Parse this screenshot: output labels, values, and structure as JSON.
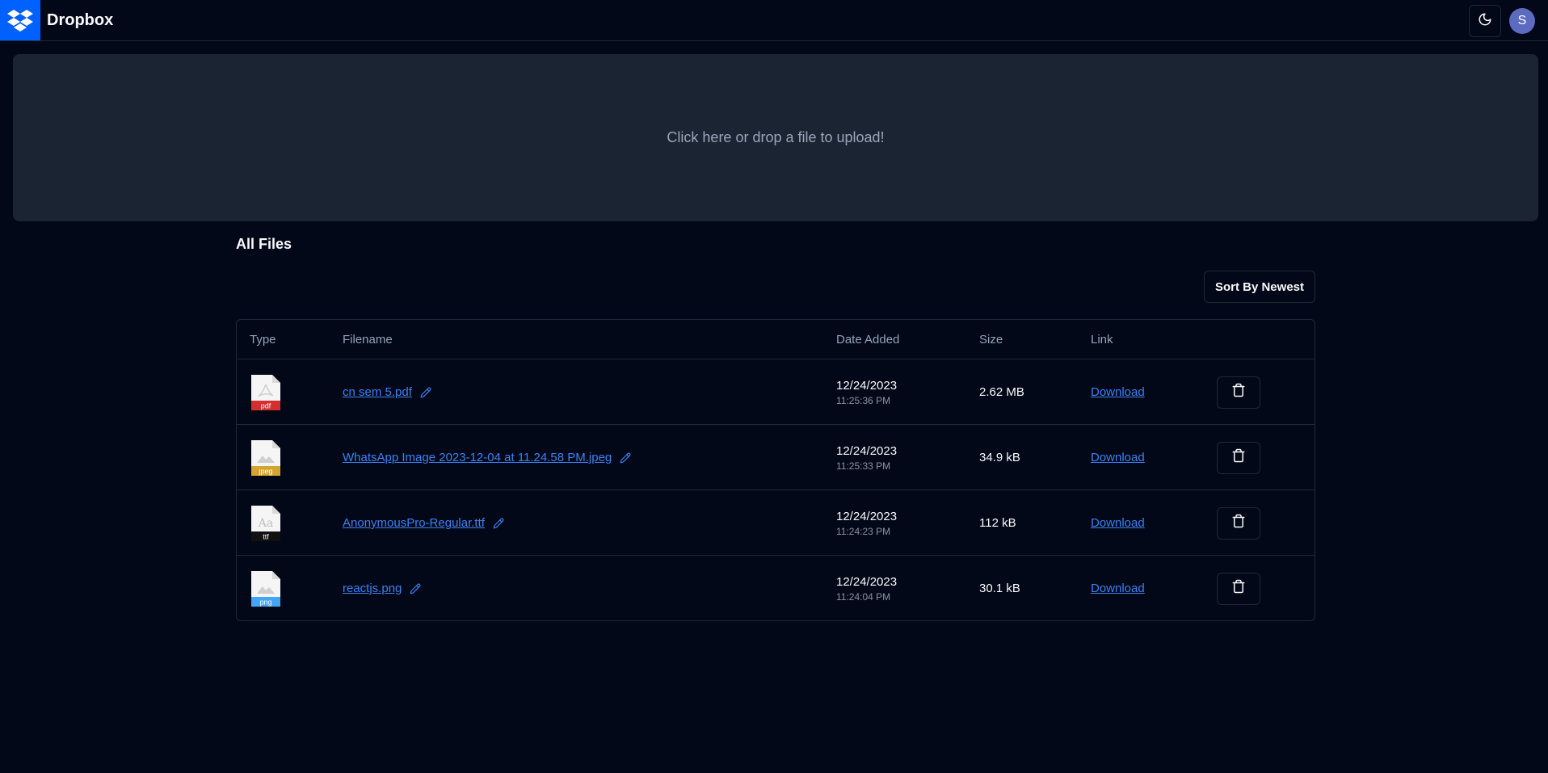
{
  "header": {
    "brand": "Dropbox",
    "logo_icon": "dropbox-logo-icon",
    "theme_icon": "moon-icon",
    "avatar_letter": "S",
    "brand_color": "#0061fe"
  },
  "dropzone": {
    "text": "Click here or drop a file to upload!"
  },
  "files_section": {
    "title": "All Files",
    "sort_label": "Sort By Newest"
  },
  "table": {
    "columns": [
      "Type",
      "Filename",
      "Date Added",
      "Size",
      "Link"
    ],
    "rows": [
      {
        "type": "pdf",
        "type_color": "#d32f2f",
        "glyph": "pdf",
        "filename": "cn sem 5.pdf",
        "date": "12/24/2023",
        "time": "11:25:36 PM",
        "size": "2.62 MB",
        "link": "Download"
      },
      {
        "type": "jpeg",
        "type_color": "#d4a530",
        "glyph": "image",
        "filename": "WhatsApp Image 2023-12-04 at 11.24.58 PM.jpeg",
        "date": "12/24/2023",
        "time": "11:25:33 PM",
        "size": "34.9 kB",
        "link": "Download"
      },
      {
        "type": "ttf",
        "type_color": "#111111",
        "glyph": "font",
        "filename": "AnonymousPro-Regular.ttf",
        "date": "12/24/2023",
        "time": "11:24:23 PM",
        "size": "112 kB",
        "link": "Download"
      },
      {
        "type": "png",
        "type_color": "#42a5f5",
        "glyph": "image",
        "filename": "reactjs.png",
        "date": "12/24/2023",
        "time": "11:24:04 PM",
        "size": "30.1 kB",
        "link": "Download"
      }
    ]
  }
}
